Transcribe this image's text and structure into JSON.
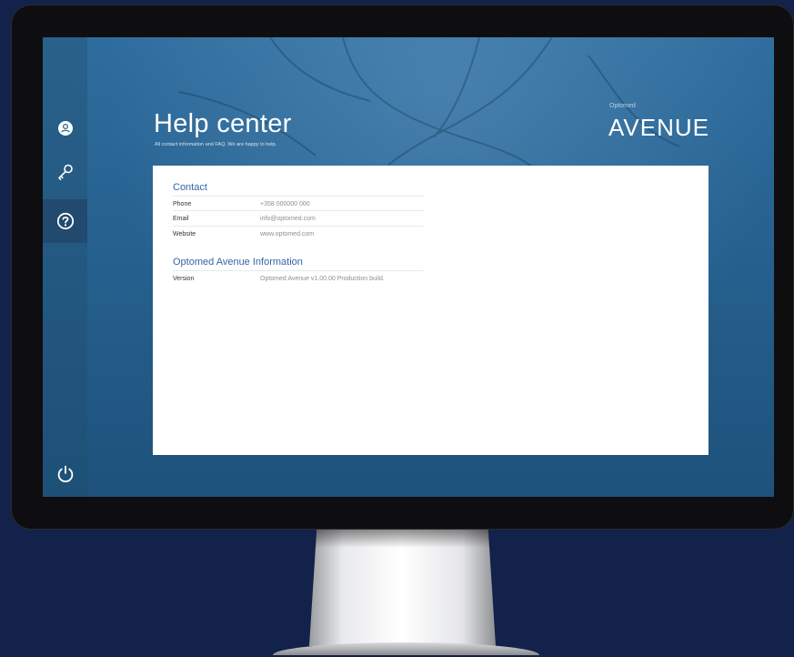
{
  "sidebar": {
    "items": [
      {
        "name": "user",
        "icon": "user-icon"
      },
      {
        "name": "key",
        "icon": "key-icon"
      },
      {
        "name": "help",
        "icon": "help-icon",
        "active": true
      },
      {
        "name": "power",
        "icon": "power-icon"
      }
    ]
  },
  "header": {
    "title": "Help center",
    "subtitle": "All contact information and FAQ. We are happy to help."
  },
  "brand": {
    "small": "Optomed",
    "name": "AVENUE"
  },
  "contact": {
    "title": "Contact",
    "rows": [
      {
        "label": "Phone",
        "value": "+358 000000 000"
      },
      {
        "label": "Email",
        "value": "info@optomed.com"
      },
      {
        "label": "Website",
        "value": "www.optomed.com"
      }
    ]
  },
  "info": {
    "title": "Optomed Avenue Information",
    "rows": [
      {
        "label": "Version",
        "value": "Optomed Avenue v1.00.00 Production build."
      }
    ]
  },
  "colors": {
    "background": "#13224a",
    "screen_accent": "#2f6d9e",
    "section_title": "#3366a6"
  }
}
